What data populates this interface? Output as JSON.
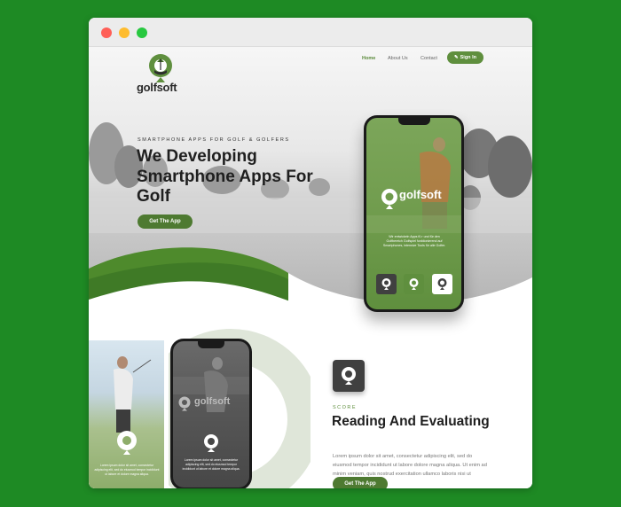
{
  "window": {
    "traffic_lights": {
      "close": "#ff5f57",
      "minimize": "#febc2e",
      "zoom": "#28c840"
    }
  },
  "brand": {
    "name": "golfsoft",
    "phone_brand": "golfsoft"
  },
  "nav": {
    "items": [
      {
        "label": "Home",
        "active": true
      },
      {
        "label": "About Us",
        "active": false
      },
      {
        "label": "Contact",
        "active": false
      }
    ],
    "signin_label": "Sign In"
  },
  "hero": {
    "eyebrow": "SMARTPHONE APPS FOR GOLF & GOLFERS",
    "headline": "We Developing Smartphone Apps For Golf",
    "cta_label": "Get The App",
    "phone_text": "Wir entwickeln Apps fü r und für den Golfbereich Golfspiel funktionierend auf Smartphones, intensive Tools für alle Golfer."
  },
  "feature": {
    "label": "SCORE",
    "title": "Reading And Evaluating",
    "body": "Lorem ipsum dolor sit amet, consectetur adipiscing elit, sed do eiusmod tempor incididunt ut labore dolore magna aliqua. Ut enim ad minim veniam, quis nostrud exercitation ullamco laboris nisi ut aliquip.",
    "cta_label": "Get The App",
    "phone_brand": "golfsoft",
    "phone_text": "Lorem ipsum dolor sit amet, consectetur adipiscing elit, sed do eiusmod tempor incididunt ut labore et dolore magna aliqua.",
    "photo_text": "Lorem ipsum dolor sit amet, consectetur adipiscing elit, sed do eiusmod tempor incididunt ut labore et dolore magna aliqua."
  },
  "colors": {
    "page_background": "#1e8a24",
    "accent": "#5f8f3e",
    "dark_green": "#4e7a31",
    "grass": "#3f7a26"
  }
}
